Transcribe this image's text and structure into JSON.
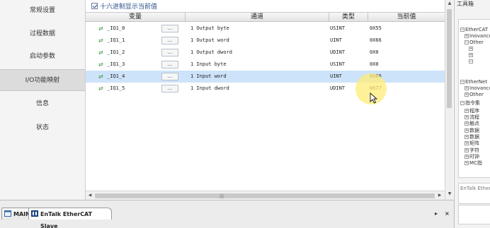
{
  "nav": {
    "items": [
      {
        "label": "常规设置",
        "active": false
      },
      {
        "label": "过程数据",
        "active": false
      },
      {
        "label": "启动参数",
        "active": false
      },
      {
        "label": "I/O功能映射",
        "active": true
      },
      {
        "label": "信息",
        "active": false
      },
      {
        "label": "状态",
        "active": false
      }
    ]
  },
  "main": {
    "hex_checkbox_label": "十六进制显示当前值",
    "hex_checked": true,
    "columns": {
      "variable": "变量",
      "channel": "通道",
      "type": "类型",
      "current_value": "当前值"
    },
    "rows": [
      {
        "variable": "_IQ1_0",
        "button": "...",
        "channel": "1 Output byte",
        "type": "USINT",
        "value": "0X55",
        "selected": false
      },
      {
        "variable": "_IQ1_1",
        "button": "...",
        "channel": "1 Output word",
        "type": "UINT",
        "value": "0X66",
        "selected": false
      },
      {
        "variable": "_IQ1_2",
        "button": "...",
        "channel": "1 Output dword",
        "type": "UDINT",
        "value": "0X0",
        "selected": false
      },
      {
        "variable": "_IQ1_3",
        "button": "...",
        "channel": "1 Input byte",
        "type": "USINT",
        "value": "0X0",
        "selected": false
      },
      {
        "variable": "_IQ1_4",
        "button": "...",
        "channel": "1 Input word",
        "type": "UINT",
        "value": "0X66",
        "selected": true
      },
      {
        "variable": "_IQ1_5",
        "button": "...",
        "channel": "1 Input dword",
        "type": "UDINT",
        "value": "0X77",
        "selected": false
      }
    ],
    "hscroll_grip": "|||"
  },
  "tabs": [
    {
      "label": "MAIN",
      "active": false
    },
    {
      "label": "EnTalk EtherCAT Slave",
      "active": true
    }
  ],
  "tabbar_right": {
    "nav_arrow": "▸",
    "close": "×"
  },
  "toolbox": {
    "title": "工具箱",
    "tree": [
      {
        "exp": "−",
        "label": "EtherCAT",
        "indent": 0
      },
      {
        "exp": "+",
        "label": "Inovance",
        "indent": 1
      },
      {
        "exp": "−",
        "label": "Other",
        "indent": 1
      },
      {
        "exp": "+",
        "label": "",
        "indent": 2
      },
      {
        "exp": "+",
        "label": "",
        "indent": 2
      },
      {
        "exp": "−",
        "label": "",
        "indent": 2
      },
      {
        "exp": "−",
        "label": "EtherNet",
        "indent": 0
      },
      {
        "exp": "+",
        "label": "Inovance",
        "indent": 1
      },
      {
        "exp": "+",
        "label": "Other",
        "indent": 1
      },
      {
        "exp": "−",
        "label": "指令集",
        "indent": 0
      },
      {
        "exp": "+",
        "label": "程序",
        "indent": 1
      },
      {
        "exp": "+",
        "label": "流程",
        "indent": 1
      },
      {
        "exp": "+",
        "label": "触点",
        "indent": 1
      },
      {
        "exp": "+",
        "label": "数据",
        "indent": 1
      },
      {
        "exp": "+",
        "label": "数据",
        "indent": 1
      },
      {
        "exp": "+",
        "label": "矩阵",
        "indent": 1
      },
      {
        "exp": "+",
        "label": "字符",
        "indent": 1
      },
      {
        "exp": "+",
        "label": "时钟",
        "indent": 1
      },
      {
        "exp": "+",
        "label": "MC指",
        "indent": 1
      }
    ],
    "footer": "EnTalk Ethernet"
  },
  "colors": {
    "selected_row": "#cde3f9",
    "hex_label": "#2a4f8a",
    "var_icon": "#3a9b3a",
    "cursor_highlight": "#ffec78"
  }
}
